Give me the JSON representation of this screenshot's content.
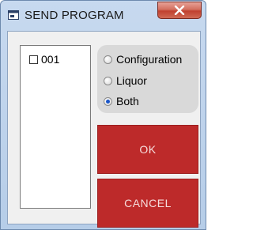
{
  "window": {
    "title": "SEND PROGRAM",
    "icon": "send-program-app-icon",
    "close_icon": "close-icon"
  },
  "program_list": {
    "items": [
      {
        "label": "001",
        "checked": false
      }
    ]
  },
  "send_options": {
    "options": [
      {
        "label": "Configuration",
        "selected": false
      },
      {
        "label": "Liquor",
        "selected": false
      },
      {
        "label": "Both",
        "selected": true
      }
    ]
  },
  "buttons": {
    "ok_label": "OK",
    "cancel_label": "CANCEL",
    "button_color": "#bd2a2a"
  }
}
